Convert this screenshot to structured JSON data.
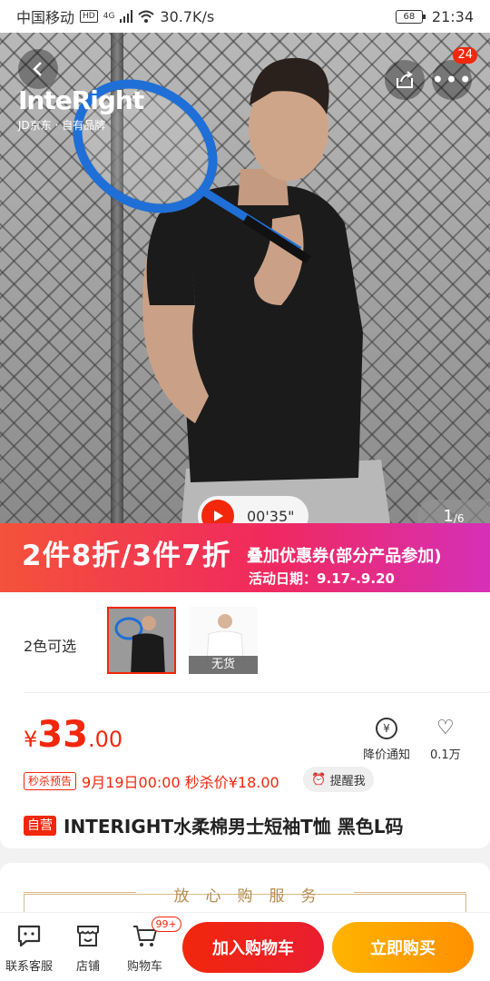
{
  "status_bar": {
    "carrier": "中国移动",
    "hd": "HD",
    "network": "4G",
    "speed": "30.7K/s",
    "battery": "68",
    "time": "21:34"
  },
  "hero": {
    "brand_name": "InteRight",
    "brand_sub": "JD京东 · 自有品牌",
    "more_badge": "24",
    "video_duration": "00'35\"",
    "page_current": "1",
    "page_total": "/6"
  },
  "promo": {
    "headline": "2件8折/3件7折",
    "subline": "叠加优惠券(部分产品参加)",
    "date": "活动日期：9.17-.9.20"
  },
  "colors": {
    "label": "2色可选",
    "out_of_stock": "无货"
  },
  "price": {
    "currency": "¥",
    "integer": "33",
    "decimal": ".00",
    "notify_label": "降价通知",
    "favorite_count": "0.1万"
  },
  "flash_sale": {
    "tag": "秒杀预告",
    "text": "9月19日00:00 秒杀价¥18.00",
    "remind_label": "提醒我"
  },
  "product": {
    "self_tag": "自营",
    "title": "INTERIGHT水柔棉男士短袖T恤 黑色L码"
  },
  "service": {
    "title": "放心购服务"
  },
  "bottom_bar": {
    "service_label": "联系客服",
    "shop_label": "店铺",
    "cart_label": "购物车",
    "cart_badge": "99+",
    "add_cart": "加入购物车",
    "buy_now": "立即购买"
  }
}
